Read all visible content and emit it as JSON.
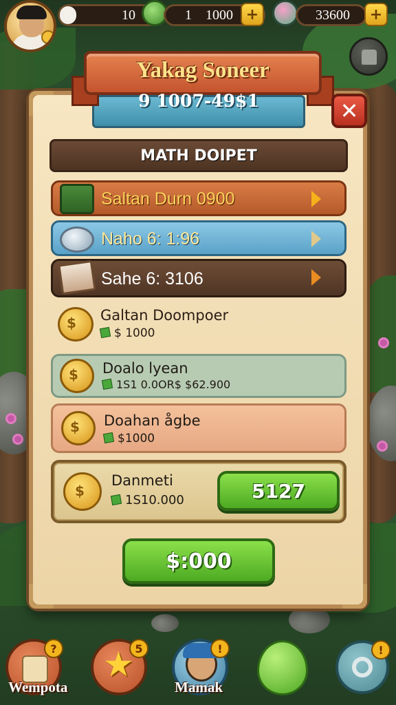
{
  "hud": {
    "resource1_value": "10",
    "resource2_value": "1",
    "resource2_amount": "1000",
    "resource3_value": "33600",
    "plus_label": "+"
  },
  "panel": {
    "title": "Yakag Soneer",
    "subtitle": "9 1007-49$1",
    "close_label": "✕",
    "section_heading": "MATH DOIPET"
  },
  "menu_rows": [
    {
      "label": "Saltan Durn 0900",
      "color": "orange"
    },
    {
      "label": "Naho 6: 1:96",
      "color": "blue"
    },
    {
      "label": "Sahe 6: 3106",
      "color": "brown"
    }
  ],
  "coin_offers": [
    {
      "name": "Galtan Doompoer",
      "price": "$ 1000"
    },
    {
      "name": "Doalo lyean",
      "price": "1S1 0.0OR$  $62.900"
    },
    {
      "name": "Doahan ågbe",
      "price": "$1000"
    },
    {
      "name": "Danmeti",
      "price": "1S10.000"
    }
  ],
  "buttons": {
    "amount_label": "5127",
    "main_label": "$:000"
  },
  "nav": [
    {
      "label": "Wempota",
      "badge": "?"
    },
    {
      "label": "",
      "badge": "5"
    },
    {
      "label": "Mamak",
      "badge": "!"
    },
    {
      "label": "",
      "badge": ""
    },
    {
      "label": "",
      "badge": "!"
    }
  ]
}
